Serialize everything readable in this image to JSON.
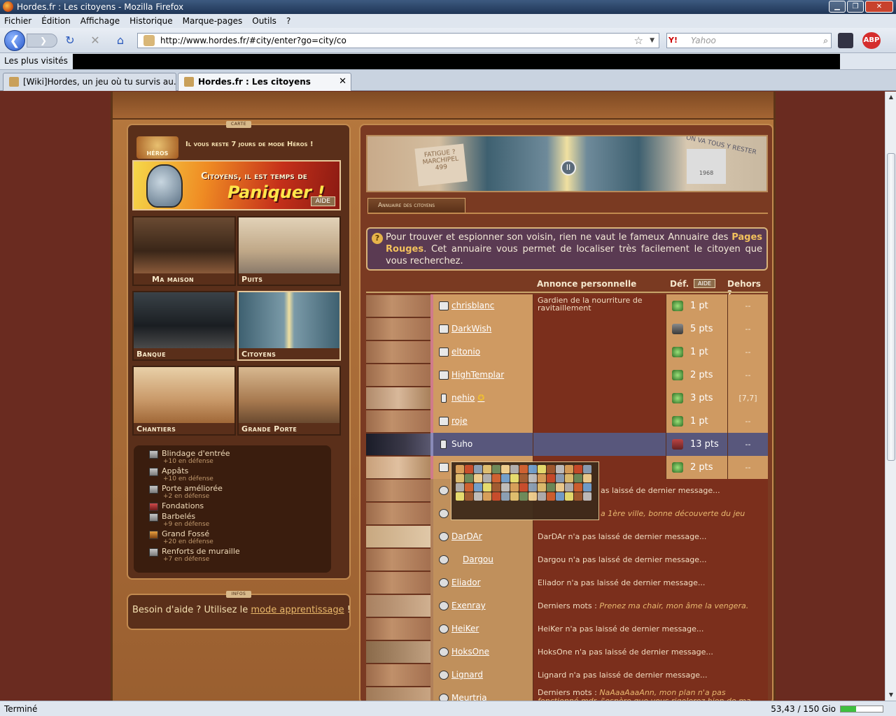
{
  "window": {
    "title": "Hordes.fr : Les citoyens - Mozilla Firefox"
  },
  "menu": [
    "Fichier",
    "Édition",
    "Affichage",
    "Historique",
    "Marque-pages",
    "Outils",
    "?"
  ],
  "nav": {
    "url": "http://www.hordes.fr/#city/enter?go=city/co",
    "search_placeholder": "Yahoo",
    "search_engine": "Y!",
    "abp": "ABP"
  },
  "bookmarks": {
    "label": "Les plus visités"
  },
  "tabs": [
    {
      "label": "[Wiki]Hordes, un jeu où tu survis au...",
      "active": false
    },
    {
      "label": "Hordes.fr : Les citoyens",
      "active": true
    }
  ],
  "status": {
    "text": "Terminé",
    "space": "53,43 / 150 Gio",
    "space_used_pct": 36
  },
  "left": {
    "map_tag": "CARTE",
    "hero_badge": "HÉROS",
    "hero_text": "Il vous reste 7 jours de mode Héros !",
    "panic_line1": "Citoyens, il est temps de",
    "panic_line2": "Paniquer !",
    "panic_aide": "AIDE",
    "tiles": [
      "Ma maison",
      "Puits",
      "Banque",
      "Citoyens",
      "Chantiers",
      "Grande Porte"
    ],
    "buildings": [
      {
        "name": "Blindage d'entrée",
        "sub": "+10 en défense"
      },
      {
        "name": "Appâts",
        "sub": "+10 en défense"
      },
      {
        "name": "Porte améliorée",
        "sub": "+2 en défense"
      },
      {
        "name": "Fondations",
        "sub": ""
      },
      {
        "name": "Barbelés",
        "sub": "+9 en défense"
      },
      {
        "name": "Grand Fossé",
        "sub": "+20 en défense"
      },
      {
        "name": "Renforts de muraille",
        "sub": "+7 en défense"
      }
    ],
    "info_tag": "INFOS",
    "info_before": "Besoin d'aide ? Utilisez le ",
    "info_link": "mode apprentissage",
    "info_after": " !"
  },
  "right": {
    "banner_sign1": "FATIGUE ? MARCHIPEL 499",
    "banner_door": "II",
    "banner_sign2": "1968",
    "banner_graffiti": "ON VA TOUS Y RESTER",
    "tab": "Annuaire des citoyens",
    "intro_before": "Pour trouver et espionner son voisin, rien ne vaut le fameux Annuaire des ",
    "intro_hl": "Pages Rouges",
    "intro_after": ". Cet annuaire vous permet de localiser très facilement le citoyen que vous recherchez.",
    "headers": {
      "annonce": "Annonce personnelle",
      "def": "Déf.",
      "aide": "AIDE",
      "dehors": "Dehors ?"
    }
  },
  "citizens": [
    {
      "name": "chrisblanc",
      "annonce": "Gardien de la nourriture de ravitaillement",
      "def": "1 pt",
      "out": "--"
    },
    {
      "name": "DarkWish",
      "annonce": "",
      "def": "5 pts",
      "out": "--"
    },
    {
      "name": "eltonio",
      "annonce": "",
      "def": "1 pt",
      "out": "--"
    },
    {
      "name": "HighTemplar",
      "annonce": "",
      "def": "2 pts",
      "out": "--"
    },
    {
      "name": "nehio",
      "annonce": "",
      "def": "3 pts",
      "out": "[7,7]",
      "star": "✪"
    },
    {
      "name": "roje",
      "annonce": "",
      "def": "1 pt",
      "out": "--"
    },
    {
      "name": "Suho",
      "annonce": "",
      "def": "13 pts",
      "out": "--",
      "me": true
    },
    {
      "name": "",
      "annonce": "",
      "def": "2 pts",
      "out": "--"
    }
  ],
  "dead": [
    {
      "name": "",
      "msg": "",
      "msg_tail": "as laissé de dernier message..."
    },
    {
      "name": "",
      "msg": "",
      "msg_tail": "a 1ère ville, bonne découverte du jeu",
      "italic": true
    },
    {
      "name": "DarDAr",
      "msg": "DarDAr n'a pas laissé de dernier message..."
    },
    {
      "name": "Dargou",
      "msg": "Dargou n'a pas laissé de dernier message..."
    },
    {
      "name": "Eliador",
      "msg": "Eliador n'a pas laissé de dernier message..."
    },
    {
      "name": "Exenray",
      "msg": "Derniers mots : ",
      "msg_tail": "Prenez ma chair, mon âme la vengera.",
      "italic": true
    },
    {
      "name": "HeiKer",
      "msg": "HeiKer n'a pas laissé de dernier message..."
    },
    {
      "name": "HoksOne",
      "msg": "HoksOne n'a pas laissé de dernier message..."
    },
    {
      "name": "Lignard",
      "msg": "Lignard n'a pas laissé de dernier message..."
    },
    {
      "name": "Meurtria",
      "msg": "Derniers mots : ",
      "msg_tail": "NaAaaAaaAnn, mon plan n'a pas fonctionné mdr, j'espère que vous rigolerez bien de ma",
      "italic": true
    }
  ],
  "popup_colors": [
    "#d9a05a",
    "#c84a2a",
    "#8aa0b8",
    "#e0c070",
    "#6a8a5a",
    "#f0d090",
    "#b0b0b0",
    "#d06030",
    "#70a0d0",
    "#e8e070",
    "#a05a30",
    "#c0c0c0"
  ]
}
